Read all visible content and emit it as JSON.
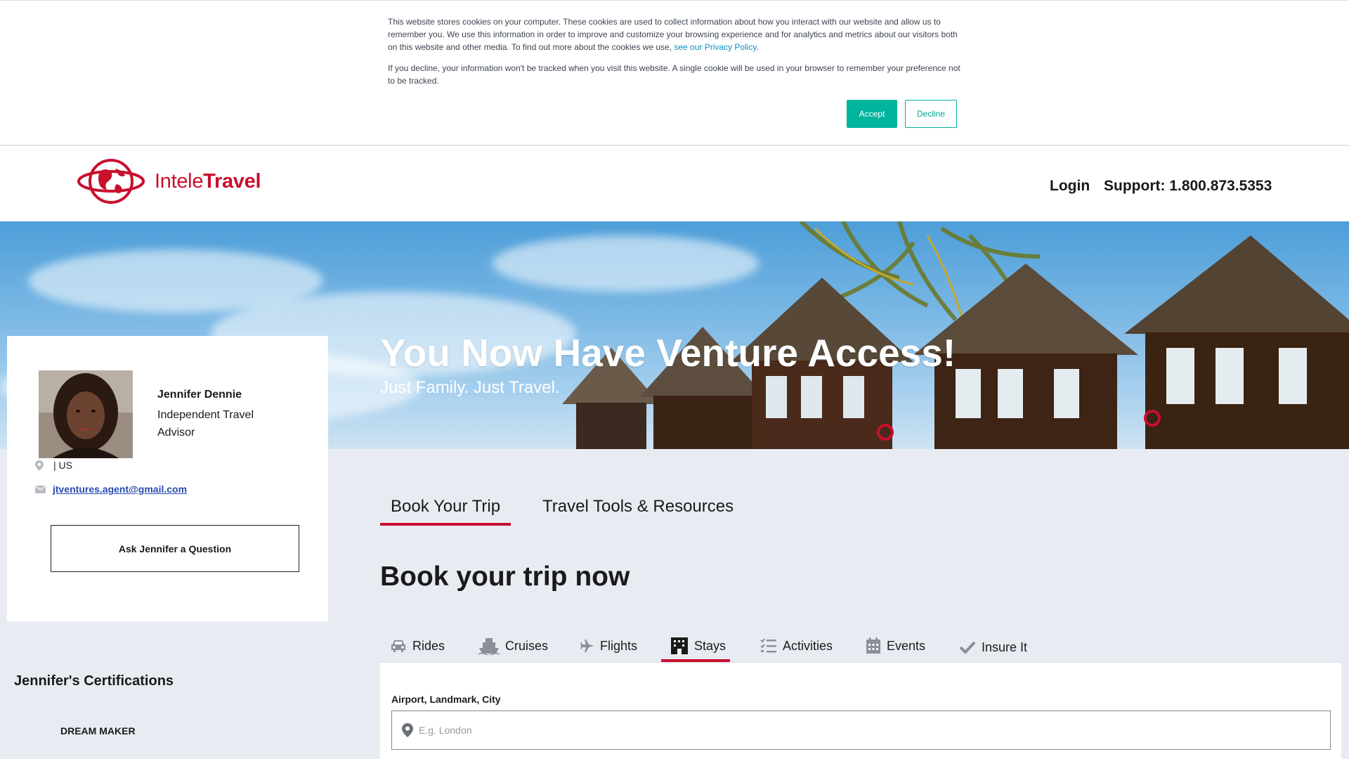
{
  "cookie_banner": {
    "paragraph1": "This website stores cookies on your computer. These cookies are used to collect information about how you interact with our website and allow us to remember you. We use this information in order to improve and customize your browsing experience and for analytics and metrics about our visitors both on this website and other media. To find out more about the cookies we use, ",
    "privacy_link": "see our Privacy Policy",
    "paragraph1_end": ".",
    "paragraph2": "If you decline, your information won't be tracked when you visit this website. A single cookie will be used in your browser to remember your preference not to be tracked.",
    "accept_label": "Accept",
    "decline_label": "Decline",
    "accent_color": "#00b49d"
  },
  "header": {
    "logo_intele": "Intele",
    "logo_travel": "Travel",
    "login_label": "Login",
    "support_label": "Support: 1.800.873.5353",
    "brand_color": "#c8102e"
  },
  "hero": {
    "title": "You Now Have Venture Access!",
    "subtitle": "Just Family. Just Travel."
  },
  "agent": {
    "name": "Jennifer Dennie",
    "role": "Independent Travel Advisor",
    "location": "| US",
    "email": "jtventures.agent@gmail.com",
    "ask_button": "Ask Jennifer a Question"
  },
  "certifications": {
    "title": "Jennifer's Certifications",
    "items": [
      "DREAM MAKER"
    ]
  },
  "main_tabs": {
    "book": "Book Your Trip",
    "tools": "Travel Tools & Resources"
  },
  "booking": {
    "title": "Book your trip now",
    "tabs": [
      "Rides",
      "Cruises",
      "Flights",
      "Stays",
      "Activities",
      "Events",
      "Insure It"
    ],
    "active_tab": "Stays",
    "field_label": "Airport, Landmark, City",
    "field_placeholder": "E.g. London"
  },
  "icons": [
    "location-icon",
    "mail-icon",
    "car-icon",
    "ship-icon",
    "plane-icon",
    "hotel-icon",
    "list-icon",
    "calendar-icon",
    "check-icon",
    "map-pin-icon"
  ]
}
